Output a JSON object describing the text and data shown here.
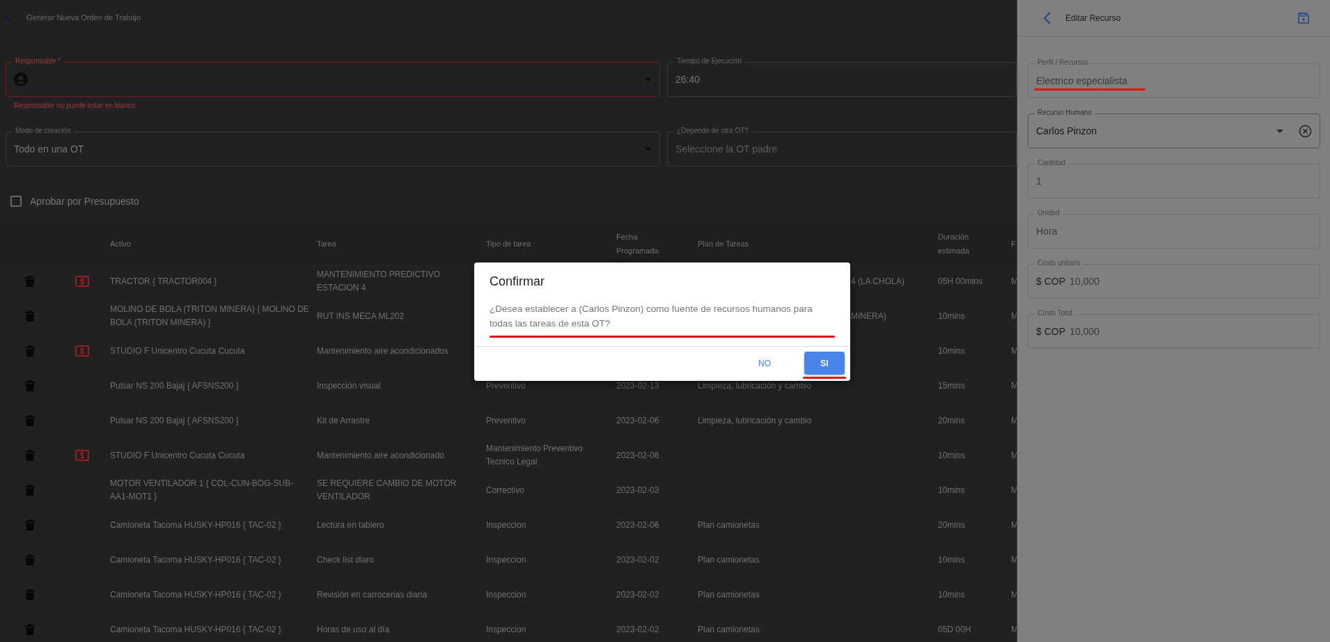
{
  "page": {
    "title": "Generar Nueva Orden de Trabajo"
  },
  "form": {
    "responsable": {
      "label": "Responsable *",
      "error": "Responsable no puede estar en blanco"
    },
    "tiempo": {
      "label": "Tiempo de Ejecución",
      "value": "26:40"
    },
    "modo": {
      "label": "Modo de creación",
      "value": "Todo en una OT"
    },
    "depende": {
      "label": "¿Depende de otra OT?",
      "placeholder": "Seleccione la OT padre"
    },
    "aprobar": {
      "label": "Aprobar por Presupuesto",
      "checked": false
    }
  },
  "table": {
    "columns": [
      "Activo",
      "Tarea",
      "Tipo de tarea",
      "Fecha Programada",
      "Plan de Tareas",
      "Duración estimada",
      "F"
    ],
    "rows": [
      {
        "budget": true,
        "activo": "TRACTOR { TRACTOR004 }",
        "tarea": "MANTENIMIENTO PREDICTIVO ESTACION 4",
        "plan": "4 (LA CHOLA)",
        "covered": true,
        "duracion": "05H 00mins",
        "column_8": "M"
      },
      {
        "budget": false,
        "activo": "MOLINO DE BOLA (TRITON MINERA) { MOLINO DE BOLA (TRITON MINERA) }",
        "tarea": "RUT INS MECA ML202",
        "plan": "MINERA)",
        "covered": true,
        "duracion": "10mins",
        "column_8": "M"
      },
      {
        "budget": true,
        "activo": "STUDIO F Unicentro Cucuta Cucuta",
        "tarea": "Mantenimiento aire acondicionados",
        "duracion": "10mins",
        "column_8": "M"
      },
      {
        "budget": false,
        "activo": "Pulsar NS 200 Bajaj { AFSNS200 }",
        "tarea": "Inspección visual",
        "tipo": "Preventivo",
        "fecha": "2023-02-13",
        "plan": "Limpieza, lubricación y cambio",
        "covered": false,
        "duracion": "15mins",
        "column_8": "M"
      },
      {
        "budget": false,
        "activo": "Pulsar NS 200 Bajaj { AFSNS200 }",
        "tarea": "Kit de Arrastre",
        "tipo": "Preventivo",
        "fecha": "2023-02-06",
        "plan": "Limpieza, lubricación y cambio",
        "covered": false,
        "duracion": "20mins",
        "column_8": "M"
      },
      {
        "budget": true,
        "activo": "STUDIO F Unicentro Cucuta Cucuta",
        "tarea": "Mantenimiento aire acondicionado",
        "tipo": "Mantenimiento Preventivo Tecnico Legal",
        "fecha": "2023-02-06",
        "duracion": "10mins",
        "column_8": "M"
      },
      {
        "budget": false,
        "activo": "MOTOR VENTILADOR 1 { COL-CUN-BOG-SUB-AA1-MOT1 }",
        "tarea": "SE REQUIERE CAMBIO DE MOTOR VENTILADOR",
        "tipo": "Correctivo",
        "fecha": "2023-02-03",
        "duracion": "10mins",
        "column_8": "M"
      },
      {
        "budget": false,
        "activo": "Camioneta Tacoma HUSKY-HP016 { TAC-02 }",
        "tarea": "Lectura en tablero",
        "tipo": "Inspeccion",
        "fecha": "2023-02-06",
        "plan": "Plan camionetas",
        "covered": false,
        "duracion": "20mins",
        "column_8": "M"
      },
      {
        "budget": false,
        "activo": "Camioneta Tacoma HUSKY-HP016 { TAC-02 }",
        "tarea": "Check list diaro",
        "tipo": "Inspeccion",
        "fecha": "2023-02-02",
        "plan": "Plan camionetas",
        "covered": false,
        "duracion": "10mins",
        "column_8": "M"
      },
      {
        "budget": false,
        "activo": "Camioneta Tacoma HUSKY-HP016 { TAC-02 }",
        "tarea": "Revisión en carrocerias diaria",
        "tipo": "Inspeccion",
        "fecha": "2023-02-02",
        "plan": "Plan camionetas",
        "covered": false,
        "duracion": "10mins",
        "column_8": "M"
      },
      {
        "budget": false,
        "activo": "Camioneta Tacoma HUSKY-HP016 { TAC-02 }",
        "tarea": "Horas de uso al día",
        "tipo": "Inspeccion",
        "fecha": "2023-02-02",
        "plan": "Plan camionetas",
        "covered": false,
        "duracion": "05D 00H",
        "column_8": "M"
      }
    ]
  },
  "panel": {
    "title": "Editar Recurso",
    "fields": [
      {
        "label": "Perfil / Recursos",
        "value": "Electrico especialista",
        "kind": "text",
        "disabled": true,
        "underlined": true
      },
      {
        "label": "Recurso Humano",
        "value": "Carlos Pinzon",
        "kind": "select",
        "disabled": false,
        "underlined": false
      },
      {
        "label": "Cantidad",
        "value": "1",
        "kind": "text",
        "disabled": true,
        "underlined": false
      },
      {
        "label": "Unidad",
        "value": "Hora",
        "kind": "text",
        "disabled": true,
        "underlined": false
      },
      {
        "label": "Costo unitario",
        "prefix": "$ COP",
        "value": "10,000",
        "kind": "money",
        "disabled": true,
        "underlined": false
      },
      {
        "label": "Costo Total",
        "prefix": "$ COP",
        "value": "10,000",
        "kind": "money",
        "disabled": true,
        "underlined": false
      }
    ]
  },
  "dialog": {
    "title": "Confirmar",
    "message": "¿Desea establecer a (Carlos Pinzon) como fuente de recursos humanos para todas las tareas de esta OT?",
    "message_underlined": true,
    "buttons": [
      {
        "label": "NO",
        "kind": "text",
        "underlined": false
      },
      {
        "label": "SI",
        "kind": "primary",
        "underlined": true
      }
    ]
  }
}
